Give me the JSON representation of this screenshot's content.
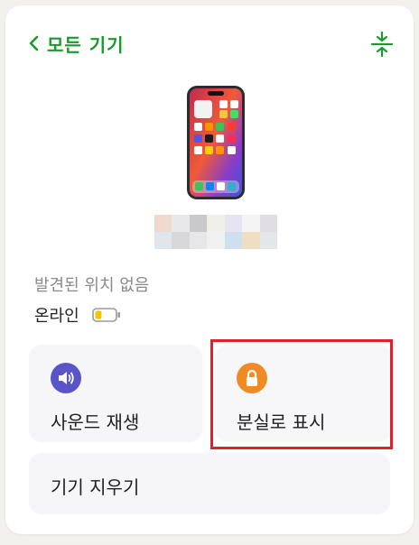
{
  "header": {
    "back_label": "모든 기기",
    "accent_color": "#1a9a2c",
    "collapse_icon": "collapse-vertical-icon"
  },
  "device": {
    "image_icon": "iphone-icon",
    "location_status": "발견된 위치 없음",
    "online_status": "온라인",
    "battery_icon": "battery-low-icon",
    "battery_color": "#f5c400"
  },
  "actions": {
    "play_sound": {
      "label": "사운드 재생",
      "icon": "speaker-icon",
      "color": "#5b54c8"
    },
    "mark_lost": {
      "label": "분실로 표시",
      "icon": "lock-icon",
      "color": "#f08a24"
    },
    "erase": {
      "label": "기기 지우기"
    }
  },
  "highlight_color": "#e0202a"
}
